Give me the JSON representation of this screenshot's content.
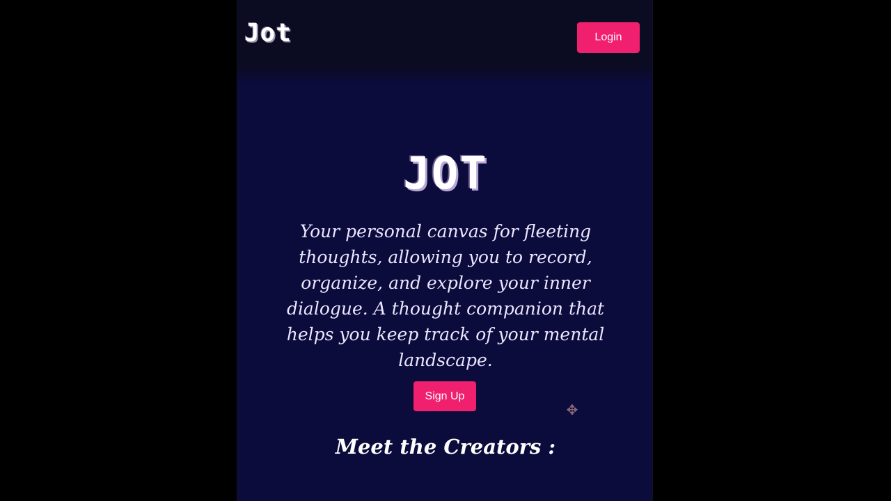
{
  "navbar": {
    "brand": "Jot",
    "login_label": "Login"
  },
  "hero": {
    "title": "JOT",
    "tagline": "Your personal canvas for fleeting thoughts, allowing you to record, organize, and explore your inner dialogue. A thought companion that helps you keep track of your mental landscape.",
    "signup_label": "Sign Up"
  },
  "creators": {
    "heading": "Meet the Creators :"
  },
  "icons": {
    "cursor": "move-cursor-icon"
  },
  "colors": {
    "accent": "#f0206e",
    "background": "#0b0b3c",
    "navbar": "#0b0b22",
    "outer": "#000000",
    "text": "#ece6ff"
  }
}
